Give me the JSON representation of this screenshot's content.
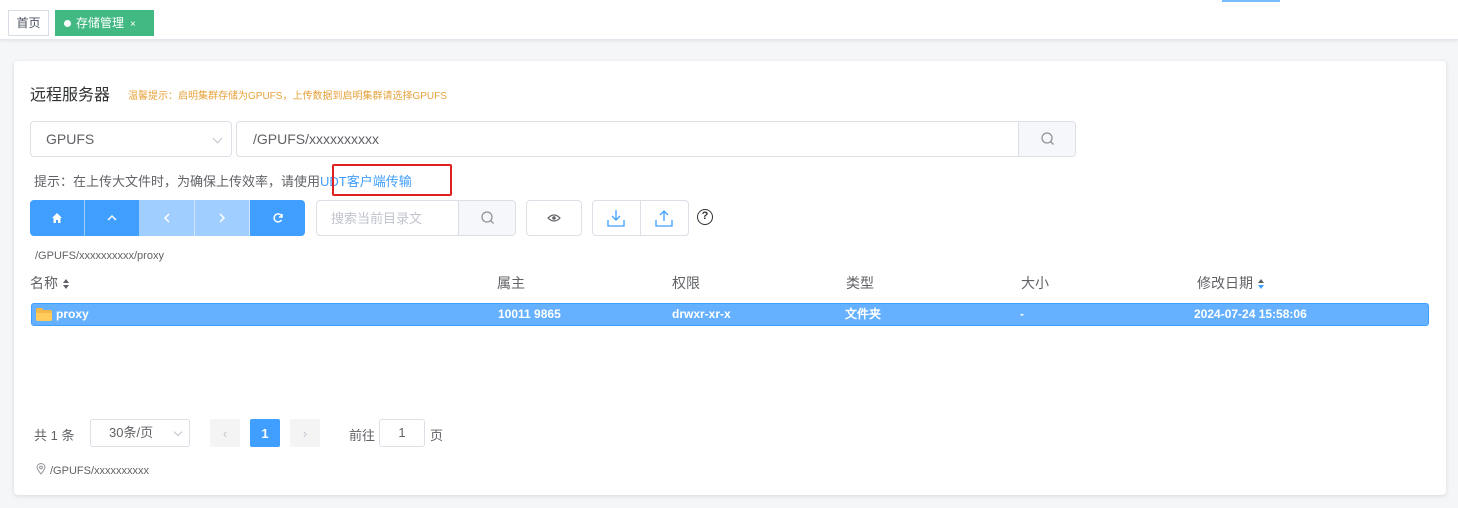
{
  "tabs": {
    "home": "首页",
    "active": "存储管理",
    "close": "×"
  },
  "panel": {
    "title": "远程服务器",
    "warning": "温馨提示：启明集群存储为GPUFS，上传数据到启明集群请选择GPUFS"
  },
  "storage_select": {
    "value": "GPUFS"
  },
  "path_input": {
    "value": "/GPUFS/xxxxxxxxxx"
  },
  "hint": {
    "text": "提示：在上传大文件时，为确保上传效率，请使用",
    "link": "UDT客户端传输"
  },
  "dir_search": {
    "placeholder": "搜索当前目录文"
  },
  "help": "?",
  "current_path": "/GPUFS/xxxxxxxxxx/proxy",
  "table": {
    "headers": [
      "名称",
      "属主",
      "权限",
      "类型",
      "大小",
      "修改日期"
    ],
    "rows": [
      {
        "name": "proxy",
        "owner": "10011 9865",
        "perm": "drwxr-xr-x",
        "type": "文件夹",
        "size": "-",
        "modified": "2024-07-24 15:58:06"
      }
    ]
  },
  "pagination": {
    "total": "共 1 条",
    "page_size": "30条/页",
    "prev": "‹",
    "current": "1",
    "next": "›",
    "goto_label": "前往",
    "goto_value": "1",
    "page_label": "页"
  },
  "footer_path": "/GPUFS/xxxxxxxxxx",
  "colors": {
    "primary": "#409eff",
    "tab_active": "#42b983",
    "warning": "#e6a23c",
    "highlight_box": "#e02020"
  }
}
